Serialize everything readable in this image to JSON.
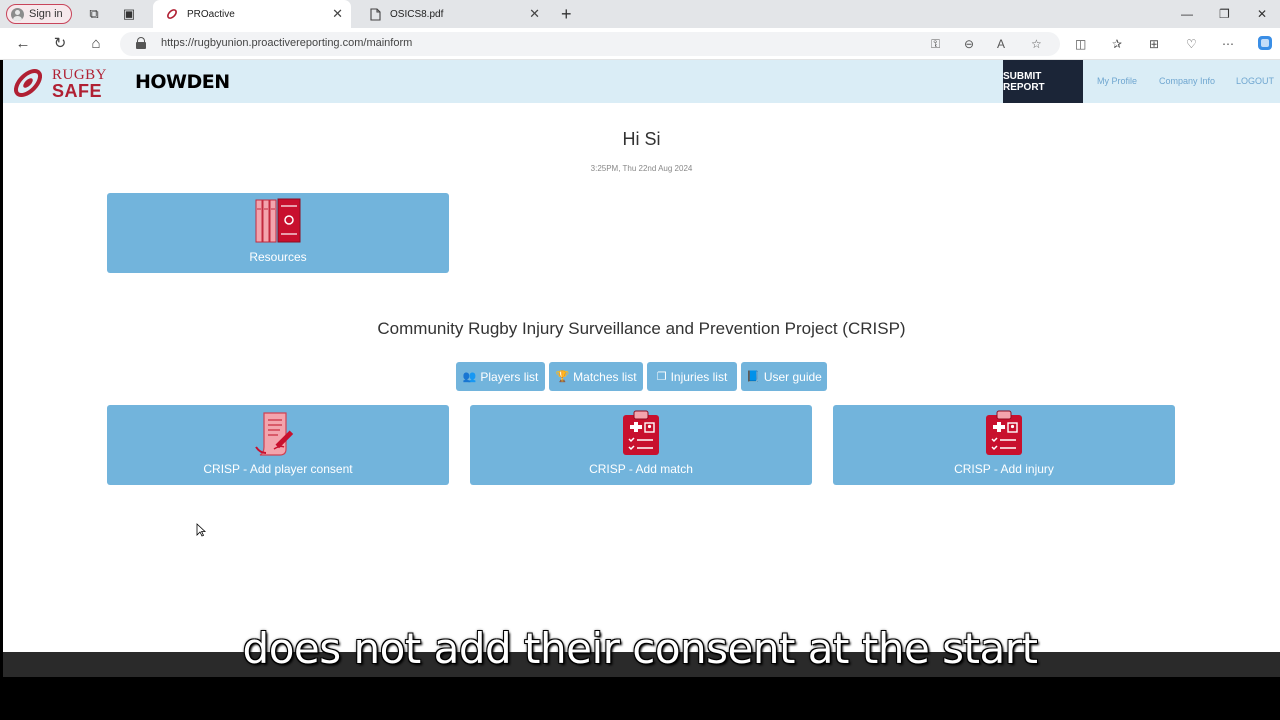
{
  "browser": {
    "signin_label": "Sign in",
    "tabs": [
      {
        "title": "PROactive",
        "active": true
      },
      {
        "title": "OSICS8.pdf",
        "active": false
      }
    ],
    "url": "https://rugbyunion.proactivereporting.com/mainform"
  },
  "header": {
    "logo_line1": "RUGBY",
    "logo_line2": "SAFE",
    "partner_logo": "HOWDEN",
    "nav": {
      "submit": "SUBMIT REPORT",
      "profile": "My Profile",
      "company": "Company Info",
      "logout": "LOGOUT"
    }
  },
  "main": {
    "greeting": "Hi Si",
    "datetime": "3:25PM, Thu 22nd Aug 2024",
    "resources_label": "Resources",
    "crisp_title": "Community Rugby Injury Surveillance and Prevention Project (CRISP)",
    "buttons": {
      "players": "Players list",
      "matches": "Matches list",
      "injuries": "Injuries list",
      "guide": "User guide"
    },
    "cards": {
      "consent": "CRISP - Add player consent",
      "match": "CRISP - Add match",
      "injury": "CRISP - Add injury"
    }
  },
  "caption": "does not add their consent at the start",
  "colors": {
    "card_blue": "#72b4dc",
    "brand_red": "#b02033",
    "header_bg": "#daedf6",
    "nav_dark": "#1b2537"
  }
}
